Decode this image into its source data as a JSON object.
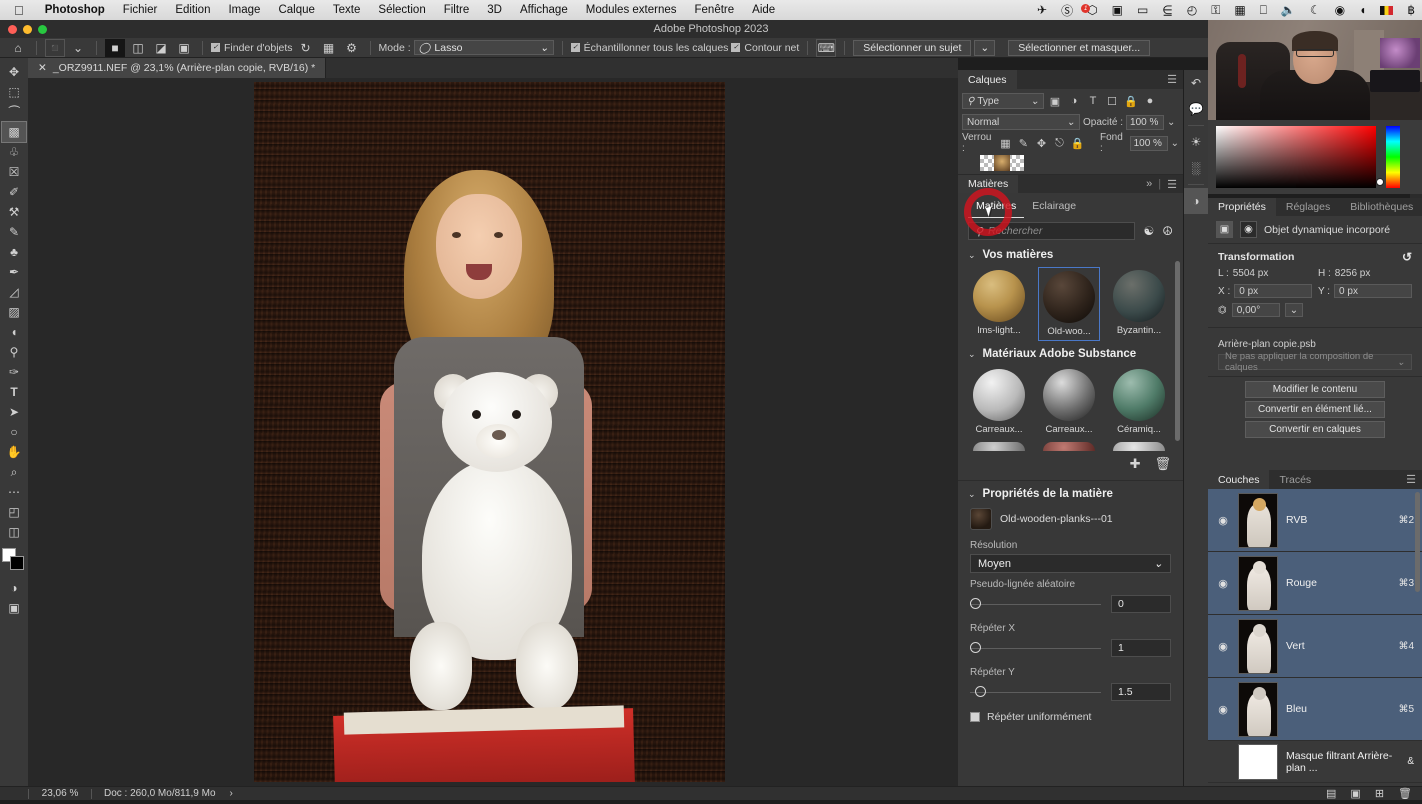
{
  "macos_menubar": {
    "apple_icon": "apple-icon",
    "items": [
      {
        "label": "Photoshop",
        "bold": true
      },
      {
        "label": "Fichier",
        "bold": false
      },
      {
        "label": "Edition",
        "bold": false
      },
      {
        "label": "Image",
        "bold": false
      },
      {
        "label": "Calque",
        "bold": false
      },
      {
        "label": "Texte",
        "bold": false
      },
      {
        "label": "Sélection",
        "bold": false
      },
      {
        "label": "Filtre",
        "bold": false
      },
      {
        "label": "3D",
        "bold": false
      },
      {
        "label": "Affichage",
        "bold": false
      },
      {
        "label": "Modules externes",
        "bold": false
      },
      {
        "label": "Fenêtre",
        "bold": false
      },
      {
        "label": "Aide",
        "bold": false
      }
    ],
    "status_icons": [
      {
        "name": "shuttle-icon",
        "glyph": "✈"
      },
      {
        "name": "creative-cloud-icon",
        "glyph": "⊘"
      },
      {
        "name": "dropbox-icon",
        "glyph": "⬡"
      },
      {
        "name": "screen-record-icon",
        "glyph": "▣"
      },
      {
        "name": "display-mirror-icon",
        "glyph": "▭"
      },
      {
        "name": "clipboard-icon",
        "glyph": "⌸"
      },
      {
        "name": "clock-icon",
        "glyph": "◴"
      },
      {
        "name": "search-binoculars-icon",
        "glyph": "♅"
      },
      {
        "name": "control-center-icon",
        "glyph": "▦"
      },
      {
        "name": "airplay-icon",
        "glyph": "⬜"
      },
      {
        "name": "volume-icon",
        "glyph": "◂"
      },
      {
        "name": "moon-icon",
        "glyph": "☾"
      },
      {
        "name": "timemachine-icon",
        "glyph": "◉"
      },
      {
        "name": "wifi-icon",
        "glyph": "◖"
      },
      {
        "name": "flag-icon",
        "glyph": ""
      },
      {
        "name": "bluetooth-icon",
        "glyph": "฿"
      }
    ]
  },
  "window": {
    "title": "Adobe Photoshop 2023"
  },
  "options_bar": {
    "home_icon": "home-icon",
    "tool_preset_label": "object-selection-tool-icon",
    "selection_modes": [
      "new-selection-icon",
      "add-to-selection-icon",
      "subtract-from-selection-icon",
      "intersect-selection-icon"
    ],
    "object_finder_label": "Finder d'objets",
    "refresh_icon": "refresh-icon",
    "show_overlay_icon": "show-objects-icon",
    "settings_icon": "gear-icon",
    "mode_label": "Mode :",
    "mode_value": "Lasso",
    "sample_all_layers_label": "Échantillonner tous les calques",
    "hard_edge_label": "Contour net",
    "feedback_icon": "feedback-icon",
    "select_subject_label": "Sélectionner un sujet",
    "select_and_mask_label": "Sélectionner et masquer..."
  },
  "document_tab": {
    "close_icon": "close-icon",
    "title": "_ORZ9911.NEF @ 23,1% (Arrière-plan copie, RVB/16) *"
  },
  "toolbar": {
    "tools": [
      {
        "name": "move-tool",
        "glyph": "✥",
        "active": false
      },
      {
        "name": "rectangular-marquee-tool",
        "glyph": "⬚",
        "active": false
      },
      {
        "name": "lasso-tool",
        "glyph": "☂",
        "active": false
      },
      {
        "name": "object-selection-tool",
        "glyph": "⬜",
        "active": true
      },
      {
        "name": "crop-tool",
        "glyph": "⌗",
        "active": false
      },
      {
        "name": "frame-tool",
        "glyph": "⌧",
        "active": false
      },
      {
        "name": "eyedropper-tool",
        "glyph": "✐",
        "active": false
      },
      {
        "name": "healing-brush-tool",
        "glyph": "⚒",
        "active": false
      },
      {
        "name": "brush-tool",
        "glyph": "✎",
        "active": false
      },
      {
        "name": "clone-stamp-tool",
        "glyph": "⚓",
        "active": false
      },
      {
        "name": "history-brush-tool",
        "glyph": "✒",
        "active": false
      },
      {
        "name": "eraser-tool",
        "glyph": "◿",
        "active": false
      },
      {
        "name": "gradient-tool",
        "glyph": "▨",
        "active": false
      },
      {
        "name": "blur-tool",
        "glyph": "◕",
        "active": false
      },
      {
        "name": "dodge-tool",
        "glyph": "⚲",
        "active": false
      },
      {
        "name": "pen-tool",
        "glyph": "✑",
        "active": false
      },
      {
        "name": "type-tool",
        "glyph": "T",
        "active": false
      },
      {
        "name": "path-selection-tool",
        "glyph": "➤",
        "active": false
      },
      {
        "name": "ellipse-tool",
        "glyph": "○",
        "active": false
      },
      {
        "name": "hand-tool",
        "glyph": "✋",
        "active": false
      },
      {
        "name": "zoom-tool",
        "glyph": "⌕",
        "active": false
      },
      {
        "name": "more-tools",
        "glyph": "⋯",
        "active": false
      },
      {
        "name": "edit-toolbar",
        "glyph": "◰",
        "active": false
      },
      {
        "name": "foreground-background-swatches",
        "glyph": "",
        "active": false
      },
      {
        "name": "quick-mask-toggle",
        "glyph": "◑",
        "active": false
      },
      {
        "name": "screen-mode-toggle",
        "glyph": "⬛",
        "active": false
      }
    ]
  },
  "status_bar": {
    "zoom": "23,06 %",
    "doc_info": "Doc : 260,0 Mo/811,9 Mo",
    "arrow": "›"
  },
  "layers_panel": {
    "tab_label": "Calques",
    "menu_icon": "panel-menu-icon",
    "filter_label": "Type",
    "filter_icons": [
      "pixel-filter-icon",
      "adjustment-filter-icon",
      "type-filter-icon",
      "shape-filter-icon",
      "smartobject-filter-icon"
    ],
    "toggle_icon": "filter-toggle-icon",
    "blend_mode": "Normal",
    "opacity_label": "Opacité :",
    "opacity_value": "100 %",
    "lock_label": "Verrou :",
    "lock_icons": [
      "lock-transparency-icon",
      "lock-image-icon",
      "lock-position-icon",
      "lock-artboard-icon",
      "lock-all-icon"
    ],
    "fill_label": "Fond :",
    "fill_value": "100 %"
  },
  "materials_panel": {
    "tab_label": "Matières",
    "collapse_icon": "collapse-icon",
    "menu_icon": "panel-menu-icon",
    "subtabs": [
      {
        "label": "Matières",
        "active": true
      },
      {
        "label": "Eclairage",
        "active": false
      }
    ],
    "search_icon": "search-icon",
    "search_placeholder": "Rechercher",
    "action_icons": [
      "substance-import-icon",
      "substance-add-icon"
    ],
    "sections": [
      {
        "title": "Vos matières",
        "chevron": "⌄",
        "items": [
          {
            "label": "lms-light...",
            "style": "sph-wood",
            "selected": false
          },
          {
            "label": "Old-woo...",
            "style": "sph-dark",
            "selected": true
          },
          {
            "label": "Byzantin...",
            "style": "sph-byz",
            "selected": false
          }
        ]
      },
      {
        "title": "Matériaux Adobe Substance",
        "chevron": "⌄",
        "items": [
          {
            "label": "Carreaux...",
            "style": "sph-tileA",
            "selected": false
          },
          {
            "label": "Carreaux...",
            "style": "sph-tileB",
            "selected": false
          },
          {
            "label": "Céramiq...",
            "style": "sph-cer",
            "selected": false
          }
        ]
      }
    ],
    "footer_icons": [
      "add-material-icon",
      "delete-material-icon"
    ],
    "properties": {
      "title": "Propriétés de la matière",
      "chevron": "⌄",
      "material_name": "Old-wooden-planks---01",
      "resolution_label": "Résolution",
      "resolution_value": "Moyen",
      "chevron_down": "⌄",
      "sliders": [
        {
          "label": "Pseudo-lignée aléatoire",
          "value": "0",
          "knob_pct": 0
        },
        {
          "label": "Répéter X",
          "value": "1",
          "knob_pct": 0
        },
        {
          "label": "Répéter Y",
          "value": "1.5",
          "knob_pct": 3
        }
      ],
      "uniform_repeat_label": "Répéter uniformément",
      "uniform_repeat_checked": false
    }
  },
  "click_highlight": {
    "name": "click-highlight-ring",
    "color": "#d2141e"
  },
  "right_rail": {
    "icons": [
      {
        "name": "history-icon",
        "glyph": "↺"
      },
      {
        "name": "comments-icon",
        "glyph": "⬜"
      },
      {
        "name": "adjustments-icon",
        "glyph": "☀"
      },
      {
        "name": "histogram-icon",
        "glyph": "▓"
      },
      {
        "name": "properties-icon",
        "glyph": "◑"
      }
    ]
  },
  "properties_panel": {
    "tabs": [
      {
        "label": "Propriétés",
        "active": true
      },
      {
        "label": "Réglages",
        "active": false
      },
      {
        "label": "Bibliothèques",
        "active": false
      }
    ],
    "menu_icon": "panel-menu-icon",
    "object_type_icons": [
      "smart-object-icon",
      "mask-icon"
    ],
    "object_type_label": "Objet dynamique incorporé",
    "transform": {
      "title": "Transformation",
      "reset_icon": "reset-icon",
      "width_label": "L :",
      "width_value": "5504 px",
      "height_label": "H :",
      "height_value": "8256 px",
      "x_label": "X :",
      "x_value": "0 px",
      "y_label": "Y :",
      "y_value": "0 px",
      "angle_icon": "angle-icon",
      "angle_value": "0,00°"
    },
    "file_name": "Arrière-plan copie.psb",
    "layer_comp": "Ne pas appliquer la composition de calques",
    "buttons": [
      {
        "label": "Modifier le contenu"
      },
      {
        "label": "Convertir en élément lié..."
      },
      {
        "label": "Convertir en calques"
      }
    ]
  },
  "channels_panel": {
    "tabs": [
      {
        "label": "Couches",
        "active": true
      },
      {
        "label": "Tracés",
        "active": false
      }
    ],
    "menu_icon": "panel-menu-icon",
    "rows": [
      {
        "name": "RVB",
        "shortcut": "⌘2",
        "eye": "◉",
        "selected": true,
        "color": true
      },
      {
        "name": "Rouge",
        "shortcut": "⌘3",
        "eye": "◉",
        "selected": true,
        "color": false
      },
      {
        "name": "Vert",
        "shortcut": "⌘4",
        "eye": "◉",
        "selected": true,
        "color": false
      },
      {
        "name": "Bleu",
        "shortcut": "⌘5",
        "eye": "◉",
        "selected": true,
        "color": false
      },
      {
        "name": "Masque filtrant Arrière-plan ...",
        "shortcut": "&",
        "eye": "",
        "selected": false,
        "color": false
      }
    ],
    "footer_icons": [
      "load-selection-icon",
      "save-selection-icon",
      "new-channel-icon",
      "delete-channel-icon"
    ]
  }
}
